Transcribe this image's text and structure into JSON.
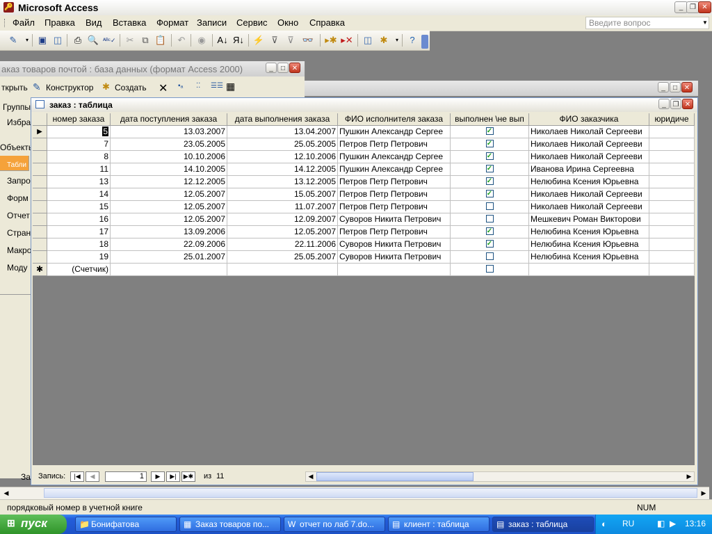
{
  "app": {
    "title": "Microsoft Access"
  },
  "menu": [
    "Файл",
    "Правка",
    "Вид",
    "Вставка",
    "Формат",
    "Записи",
    "Сервис",
    "Окно",
    "Справка"
  ],
  "ask_placeholder": "Введите вопрос",
  "db_window": {
    "title": "аказ товаров почтой : база данных (формат Access 2000)",
    "toolbar": {
      "open": "ткрыть",
      "design": "Конструктор",
      "create": "Создать"
    },
    "side": {
      "groups": "Группы",
      "favorites": "Избра",
      "objects": "Объекты"
    },
    "objects": [
      "Табли",
      "Запро",
      "Форм",
      "Отчет",
      "Стран",
      "Макро",
      "Моду"
    ],
    "footer_label": "За"
  },
  "table_window": {
    "title": "заказ : таблица",
    "columns": [
      "номер заказа",
      "дата  поступления заказа",
      "дата выполнения заказа",
      "ФИО  исполнителя заказа",
      "выполнен \\не вып",
      "ФИО  заказчика",
      "юридиче"
    ],
    "rows": [
      {
        "num": "5",
        "recv": "13.03.2007",
        "done": "13.04.2007",
        "exec": "Пушкин Александр Сергее",
        "flag": true,
        "client": "Николаев Николай Сергееви"
      },
      {
        "num": "7",
        "recv": "23.05.2005",
        "done": "25.05.2005",
        "exec": "Петров Петр Петрович",
        "flag": true,
        "client": "Николаев Николай Сергееви"
      },
      {
        "num": "8",
        "recv": "10.10.2006",
        "done": "12.10.2006",
        "exec": "Пушкин Александр Сергее",
        "flag": true,
        "client": "Николаев Николай Сергееви"
      },
      {
        "num": "11",
        "recv": "14.10.2005",
        "done": "14.12.2005",
        "exec": "Пушкин Александр Сергее",
        "flag": true,
        "client": "Иванова Ирина Сергеевна"
      },
      {
        "num": "13",
        "recv": "12.12.2005",
        "done": "13.12.2005",
        "exec": "Петров Петр Петрович",
        "flag": true,
        "client": "Нелюбина Ксения Юрьевна"
      },
      {
        "num": "14",
        "recv": "12.05.2007",
        "done": "15.05.2007",
        "exec": "Петров Петр Петрович",
        "flag": true,
        "client": "Николаев Николай Сергееви"
      },
      {
        "num": "15",
        "recv": "12.05.2007",
        "done": "11.07.2007",
        "exec": "Петров Петр Петрович",
        "flag": false,
        "client": "Николаев Николай Сергееви"
      },
      {
        "num": "16",
        "recv": "12.05.2007",
        "done": "12.09.2007",
        "exec": "Суворов Никита Петрович",
        "flag": false,
        "client": "Мешкевич Роман Викторови"
      },
      {
        "num": "17",
        "recv": "13.09.2006",
        "done": "12.05.2007",
        "exec": "Петров Петр Петрович",
        "flag": true,
        "client": "Нелюбина Ксения Юрьевна"
      },
      {
        "num": "18",
        "recv": "22.09.2006",
        "done": "22.11.2006",
        "exec": "Суворов Никита Петрович",
        "flag": true,
        "client": "Нелюбина Ксения Юрьевна"
      },
      {
        "num": "19",
        "recv": "25.01.2007",
        "done": "25.05.2007",
        "exec": "Суворов Никита Петрович",
        "flag": false,
        "client": "Нелюбина Ксения Юрьевна"
      }
    ],
    "new_row": {
      "num": "(Счетчик)",
      "flag": false
    },
    "nav": {
      "label": "Запись:",
      "current": "1",
      "of": "из",
      "total": "11"
    }
  },
  "status": {
    "text": "порядковый номер в учетной книге",
    "num": "NUM"
  },
  "taskbar": {
    "start": "пуск",
    "tasks": [
      "Бонифатова",
      "Заказ товаров по...",
      "отчет по лаб 7.do...",
      "клиент : таблица",
      "заказ : таблица"
    ],
    "active_task": 4,
    "lang": "RU",
    "clock": "13:16"
  },
  "colors": {
    "accent_orange": "#f5a23a",
    "check_green": "#21a121",
    "taskbar_blue": "#245edb"
  }
}
